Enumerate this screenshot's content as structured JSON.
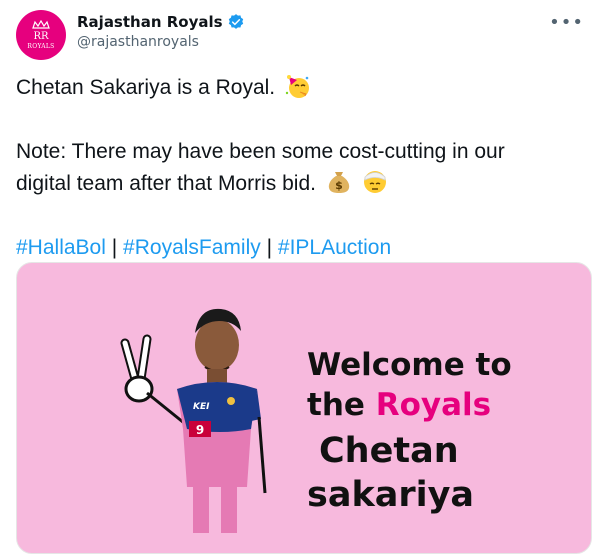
{
  "account": {
    "display_name": "Rajasthan Royals",
    "handle": "@rajasthanroyals",
    "verified": true,
    "avatar_text": "ROYALS",
    "avatar_color": "#e6007e"
  },
  "tweet": {
    "line1": "Chetan Sakariya is a Royal.",
    "line2": "Note: There may have been some cost-cutting in our",
    "line3": "digital team after that Morris bid.",
    "hashtags": [
      "#HallaBol",
      "#RoyalsFamily",
      "#IPLAuction"
    ],
    "separator": "|",
    "emojis": [
      "party-face",
      "money-bag",
      "bandage-face"
    ]
  },
  "media": {
    "line1": "Welcome to",
    "line2_prefix": "the",
    "line2_highlight": "Royals",
    "line3": "Chetan",
    "line4": "sakariya",
    "background": "#f7b9dd",
    "highlight_color": "#e6007e",
    "jersey_text": "KEI",
    "jersey_number": "9"
  },
  "menu": {
    "more_label": "•••"
  },
  "colors": {
    "link": "#1d9bf0",
    "verified": "#1d9bf0",
    "muted": "#536471"
  }
}
